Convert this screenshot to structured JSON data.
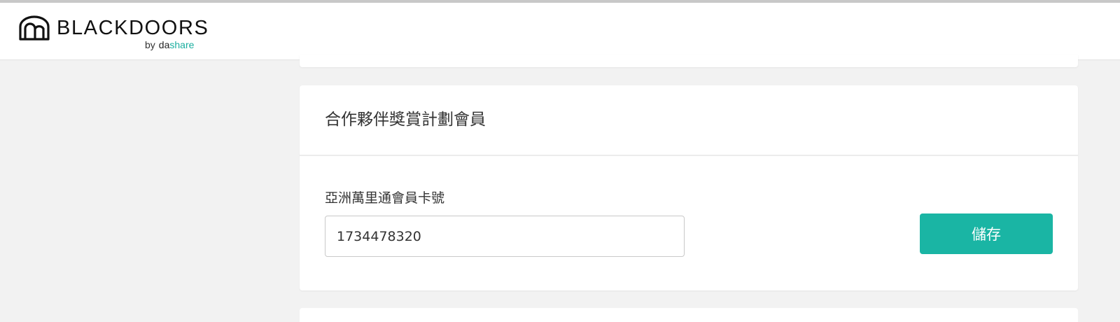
{
  "brand": {
    "name": "BLACKDOORS",
    "by": "by",
    "partner_prefix": "da",
    "partner_suffix": "share",
    "accent_color": "#1ab5a4",
    "icon": "arch-door-logo"
  },
  "membership_card": {
    "title": "合作夥伴獎賞計劃會員",
    "field_label": "亞洲萬里通會員卡號",
    "field_value": "1734478320",
    "save_label": "儲存"
  }
}
